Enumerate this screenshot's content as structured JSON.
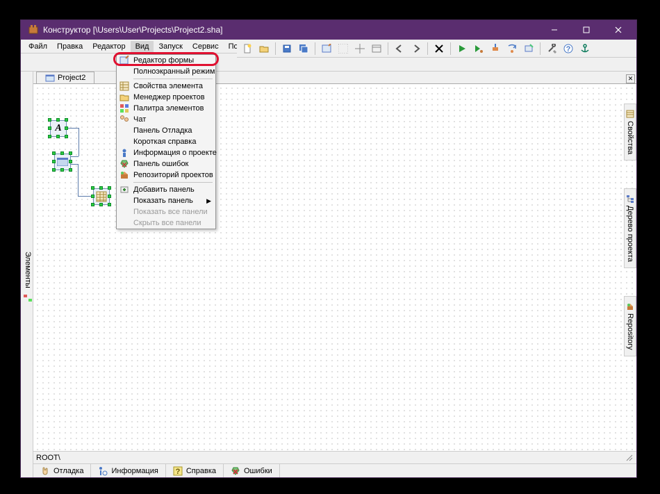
{
  "title": "Конструктор [\\Users\\User\\Projects\\Project2.sha]",
  "menu": {
    "file": "Файл",
    "edit": "Правка",
    "editor": "Редактор",
    "view": "Вид",
    "run": "Запуск",
    "service": "Сервис",
    "help": "Помощь"
  },
  "tab": {
    "project": "Project2"
  },
  "left_tab": {
    "elements": "Элементы"
  },
  "right_tabs": {
    "props": "Свойства",
    "tree": "Дерево проекта",
    "repo": "Repository"
  },
  "status": {
    "root": "ROOT\\"
  },
  "bottom": {
    "debug": "Отладка",
    "info": "Информация",
    "help": "Справка",
    "errors": "Ошибки"
  },
  "dropdown": {
    "form_editor": "Редактор формы",
    "fullscreen": "Полноэкранный режим",
    "elem_props": "Свойства элемента",
    "proj_mgr": "Менеджер проектов",
    "palette": "Палитра элементов",
    "chat": "Чат",
    "debug_panel": "Панель Отладка",
    "short_help": "Короткая справка",
    "proj_info": "Информация о проекте",
    "err_panel": "Панель ошибок",
    "repo_proj": "Репозиторий проектов",
    "add_panel": "Добавить панель",
    "show_panel": "Показать панель",
    "show_all": "Показать все панели",
    "hide_all": "Скрыть все панели"
  }
}
